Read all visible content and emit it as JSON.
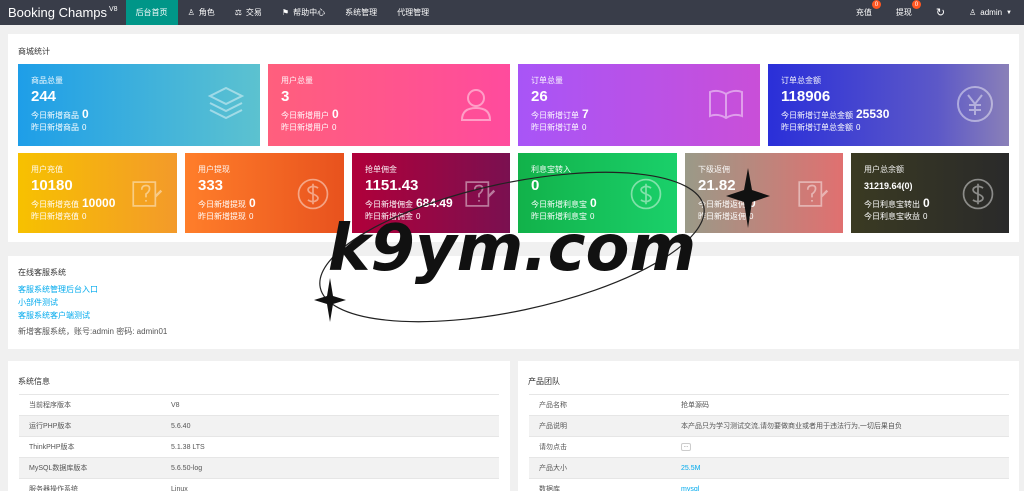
{
  "header": {
    "brand": "Booking Champs",
    "version": "V8",
    "nav": [
      {
        "icon": "",
        "label": "后台首页"
      },
      {
        "icon": "user-icon",
        "label": "角色"
      },
      {
        "icon": "scale-icon",
        "label": "交易"
      },
      {
        "icon": "flag-icon",
        "label": "帮助中心"
      },
      {
        "icon": "",
        "label": "系统管理"
      },
      {
        "icon": "",
        "label": "代理管理"
      }
    ],
    "recharge_label": "充值",
    "recharge_badge": "0",
    "withdraw_label": "提现",
    "withdraw_badge": "0",
    "user_label": "admin"
  },
  "stats": {
    "title": "商城统计",
    "cards": [
      {
        "label": "商品总量",
        "value": "244",
        "row1_label": "今日新增商品",
        "row1_value": "0",
        "row2_label": "昨日新增商品",
        "row2_value": "0",
        "icon": "layers-icon"
      },
      {
        "label": "用户总量",
        "value": "3",
        "row1_label": "今日新增用户",
        "row1_value": "0",
        "row2_label": "昨日新增用户",
        "row2_value": "0",
        "icon": "users-icon"
      },
      {
        "label": "订单总量",
        "value": "26",
        "row1_label": "今日新增订单",
        "row1_value": "7",
        "row2_label": "昨日新增订单",
        "row2_value": "0",
        "icon": "book-icon"
      },
      {
        "label": "订单总金额",
        "value": "118906",
        "row1_label": "今日新增订单总金额",
        "row1_value": "25530",
        "row2_label": "昨日新增订单总金额",
        "row2_value": "0",
        "icon": "yen-icon"
      },
      {
        "label": "用户充值",
        "value": "10180",
        "row1_label": "今日新增充值",
        "row1_value": "10000",
        "row2_label": "昨日新增充值",
        "row2_value": "0",
        "icon": "edit-icon"
      },
      {
        "label": "用户提现",
        "value": "333",
        "row1_label": "今日新增提现",
        "row1_value": "0",
        "row2_label": "昨日新增提现",
        "row2_value": "0",
        "icon": "dollar-icon"
      },
      {
        "label": "抢单佣金",
        "value": "1151.43",
        "row1_label": "今日新增佣金",
        "row1_value": "684.49",
        "row2_label": "昨日新增佣金",
        "row2_value": "0",
        "icon": "edit-icon"
      },
      {
        "label": "利息宝转入",
        "value": "0",
        "row1_label": "今日新增利息宝",
        "row1_value": "0",
        "row2_label": "昨日新增利息宝",
        "row2_value": "0",
        "icon": "dollar-icon"
      },
      {
        "label": "下级返佣",
        "value": "21.82",
        "row1_label": "今日新增返佣",
        "row1_value": "0",
        "row2_label": "昨日新增返佣",
        "row2_value": "0",
        "icon": "edit-icon"
      },
      {
        "label": "用户总余额",
        "value": "31219.64(0)",
        "row1_label": "今日利息宝转出",
        "row1_value": "0",
        "row2_label": "今日利息宝收益",
        "row2_value": "0",
        "icon": "dollar-icon"
      }
    ]
  },
  "service": {
    "title": "在线客服系统",
    "links": [
      "客服系统管理后台入口",
      "小部件测试",
      "客服系统客户端测试"
    ],
    "info": "新增客服系统，账号:admin 密码: admin01"
  },
  "sysinfo": {
    "title": "系统信息",
    "rows": [
      [
        "当前程序版本",
        "V8"
      ],
      [
        "运行PHP版本",
        "5.6.40"
      ],
      [
        "ThinkPHP版本",
        "5.1.38 LTS"
      ],
      [
        "MySQL数据库版本",
        "5.6.50-log"
      ],
      [
        "服务器操作系统",
        "Linux"
      ]
    ]
  },
  "team": {
    "title": "产品团队",
    "rows": [
      [
        "产品名称",
        "抢单源码"
      ],
      [
        "产品说明",
        "本产品只为学习测试交流,请勿要做商业或者用于违法行为,一切后果自负"
      ],
      [
        "请勿点击",
        ""
      ],
      [
        "产品大小",
        "25.5M"
      ],
      [
        "数据库",
        "mysql"
      ]
    ]
  },
  "watermark": "k9ym.com"
}
